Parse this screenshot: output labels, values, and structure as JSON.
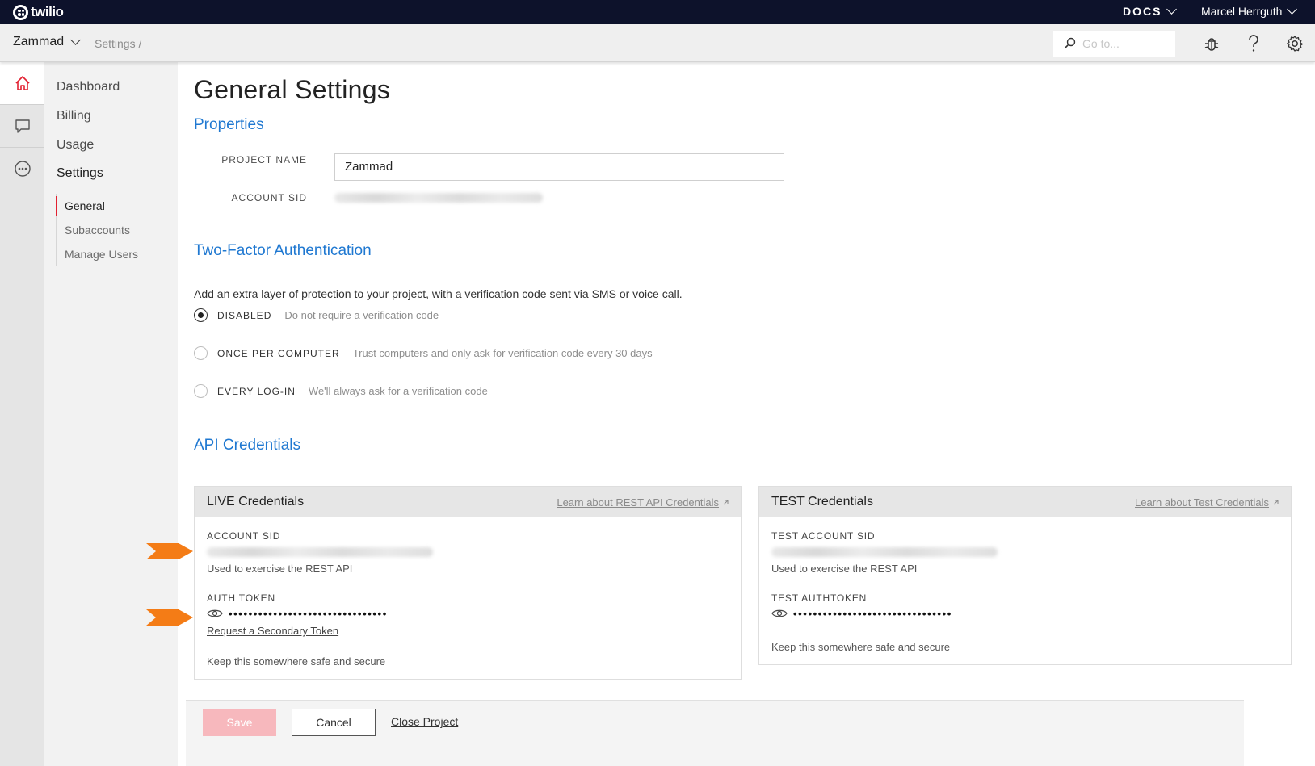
{
  "topbar": {
    "brand": "twilio",
    "docs_label": "DOCS",
    "user_name": "Marcel Herrguth"
  },
  "subbar": {
    "project_name": "Zammad",
    "breadcrumb": "Settings  /",
    "goto_placeholder": "Go to..."
  },
  "rail": {
    "icons": [
      "home-icon",
      "chat-icon",
      "more-icon"
    ]
  },
  "nav": {
    "items": [
      {
        "label": "Dashboard"
      },
      {
        "label": "Billing"
      },
      {
        "label": "Usage"
      },
      {
        "label": "Settings"
      }
    ],
    "sub_items": [
      {
        "label": "General"
      },
      {
        "label": "Subaccounts"
      },
      {
        "label": "Manage Users"
      }
    ]
  },
  "page": {
    "title": "General Settings",
    "properties": {
      "heading": "Properties",
      "project_name_label": "PROJECT NAME",
      "project_name_value": "Zammad",
      "account_sid_label": "ACCOUNT SID"
    },
    "two_factor": {
      "heading": "Two-Factor Authentication",
      "description": "Add an extra layer of protection to your project, with a verification code sent via SMS or voice call.",
      "options": [
        {
          "label": "DISABLED",
          "hint": "Do not require a verification code",
          "selected": true
        },
        {
          "label": "ONCE PER COMPUTER",
          "hint": "Trust computers and only ask for verification code every 30 days",
          "selected": false
        },
        {
          "label": "EVERY LOG-IN",
          "hint": "We'll always ask for a verification code",
          "selected": false
        }
      ]
    },
    "api_credentials": {
      "heading": "API Credentials",
      "live": {
        "title": "LIVE Credentials",
        "link": "Learn about REST API Credentials",
        "sid_label": "ACCOUNT SID",
        "sid_note": "Used to exercise the REST API",
        "token_label": "AUTH TOKEN",
        "token_mask": "••••••••••••••••••••••••••••••••",
        "secondary_link": "Request a Secondary Token",
        "keep_note": "Keep this somewhere safe and secure"
      },
      "test": {
        "title": "TEST Credentials",
        "link": "Learn about Test Credentials",
        "sid_label": "TEST ACCOUNT SID",
        "sid_note": "Used to exercise the REST API",
        "token_label": "TEST AUTHTOKEN",
        "token_mask": "••••••••••••••••••••••••••••••••",
        "keep_note": "Keep this somewhere safe and secure"
      }
    }
  },
  "actions": {
    "save": "Save",
    "cancel": "Cancel",
    "close_project": "Close Project"
  },
  "colors": {
    "topbar_bg": "#0d122b",
    "link_blue": "#1f78d1",
    "twilio_red": "#e22131",
    "save_disabled": "#f7b8bd",
    "annotation_arrow": "#f47c16"
  }
}
